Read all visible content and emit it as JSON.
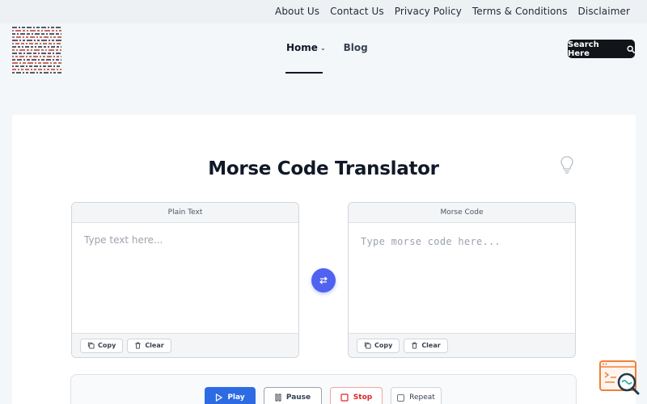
{
  "top_nav": [
    "About Us",
    "Contact Us",
    "Privacy Policy",
    "Terms & Conditions",
    "Disclaimer"
  ],
  "main_nav": {
    "home": "Home",
    "blog": "Blog"
  },
  "search": {
    "label": "Search Here"
  },
  "page": {
    "title": "Morse Code Translator"
  },
  "plain_panel": {
    "header": "Plain Text",
    "placeholder": "Type text here...",
    "copy": "Copy",
    "clear": "Clear"
  },
  "morse_panel": {
    "header": "Morse Code",
    "placeholder": "Type morse code here...",
    "copy": "Copy",
    "clear": "Clear"
  },
  "controls": {
    "play": "Play",
    "pause": "Pause",
    "stop": "Stop",
    "repeat": "Repeat"
  },
  "colors": {
    "accent": "#2d6be4",
    "swap": "#4f63f0",
    "stop": "#dc2626",
    "dark": "#111418"
  }
}
